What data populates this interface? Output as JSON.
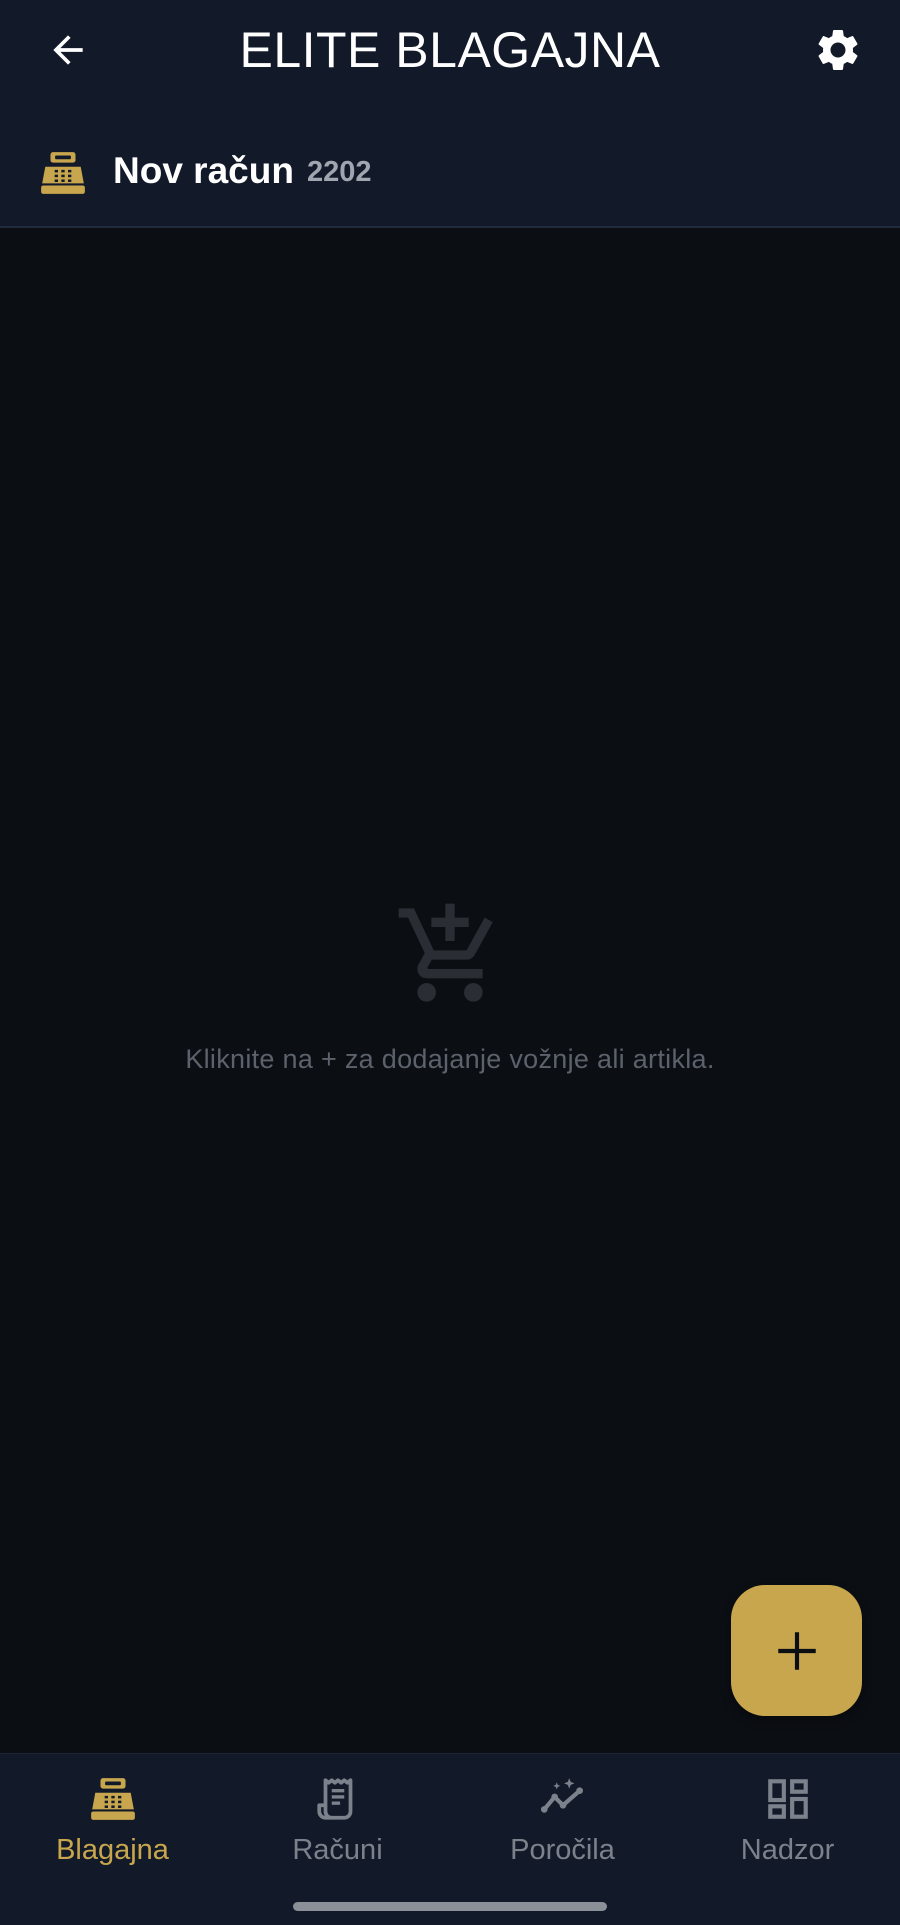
{
  "app_bar": {
    "title": "ELITE BLAGAJNA",
    "back_icon": "arrow-left-icon",
    "settings_icon": "gear-icon"
  },
  "receipt": {
    "icon": "cash-register-icon",
    "title": "Nov račun",
    "number": "2202"
  },
  "empty_state": {
    "icon": "cart-add-icon",
    "message": "Kliknite na + za dodajanje vožnje ali artikla."
  },
  "fab": {
    "icon": "plus-icon"
  },
  "bottom_nav": {
    "items": [
      {
        "label": "Blagajna",
        "icon": "cash-register-icon",
        "active": true
      },
      {
        "label": "Računi",
        "icon": "receipt-icon",
        "active": false
      },
      {
        "label": "Poročila",
        "icon": "sparkle-chart-icon",
        "active": false
      },
      {
        "label": "Nadzor",
        "icon": "dashboard-icon",
        "active": false
      }
    ]
  },
  "colors": {
    "accent": "#c8a64e",
    "app_bar_bg": "#121a29",
    "body_bg": "#0b0e13",
    "inactive": "#7c828c"
  }
}
